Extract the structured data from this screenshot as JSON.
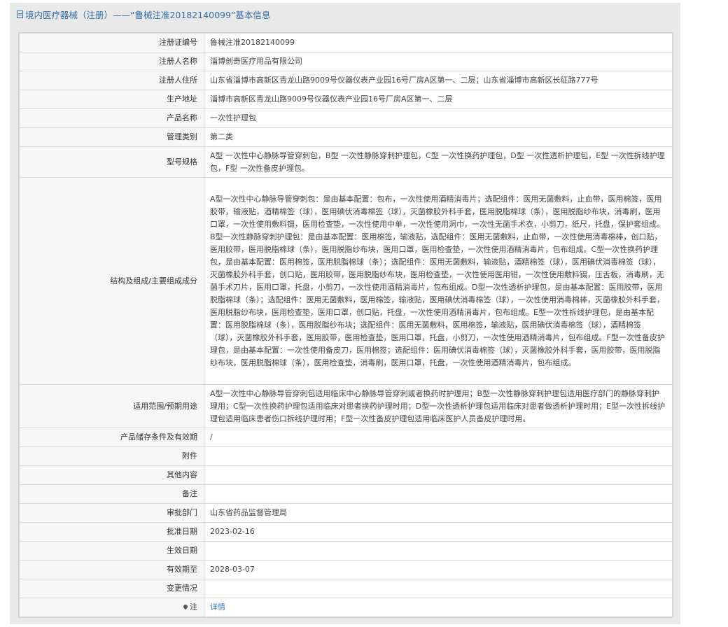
{
  "title": "境内医疗器械（注册）——“鲁械注准20182140099”基本信息",
  "rows": [
    {
      "label": "注册证编号",
      "value": "鲁械注准20182140099"
    },
    {
      "label": "注册人名称",
      "value": "淄博创奇医疗用品有限公司"
    },
    {
      "label": "注册人住所",
      "value": "山东省淄博市高新区青龙山路9009号仪器仪表产业园16号厂房A区第一、二层；山东省淄博市高新区长征路777号"
    },
    {
      "label": "生产地址",
      "value": "淄博市高新区青龙山路9009号仪器仪表产业园16号厂房A区第一、二层"
    },
    {
      "label": "产品名称",
      "value": "一次性护理包"
    },
    {
      "label": "管理类别",
      "value": "第二类"
    },
    {
      "label": "型号规格",
      "value": "A型 一次性中心静脉导管穿刺包，B型 一次性静脉穿刺护理包，C型 一次性换药护理包，D型 一次性透析护理包，E型 一次性拆线护理包，F型 一次性备皮护理包。"
    },
    {
      "label": "结构及组成/主要组成成分",
      "value": "A型一次性中心静脉导管穿刺包：是由基本配置：包布，一次性使用酒精消毒片；选配组件：医用无菌敷料，止血带，医用棉签，医用胶带，输液贴，酒精棉签（球），医用碘伏消毒棉签（球），灭菌橡胶外科手套，医用脱脂棉球（条），医用脱脂纱布块，消毒刷，医用口罩，一次性使用敷料镊，医用检查垫，一次性使用中单，一次性使用洞巾，一次性无菌手术衣，小剪刀，纸尺，托盘，保护套组成。\nB型一次性静脉穿刺护理包：是由基本配置：医用棉签，输液贴，选配组件：医用无菌敷料，止血带，一次性使用消毒棉棒，创口贴，医用胶带，医用脱脂棉球（条），医用脱脂纱布块，医用口罩，医用检查垫，一次性使用酒精消毒片，包布组成。C型一次性换药护理包，是由基本配置：医用棉签，医用脱脂棉球（条）；选配组件：医用无菌敷料，输液贴，酒精棉签（球），医用碘伏消毒棉签（球），灭菌橡胶外科手套，创口贴，医用胶带，医用脱脂纱布块，医用检查垫，一次性使用医用钳，一次性使用敷料镊，压舌板，消毒刷，无菌手术刀片，医用口罩，托盘，小剪刀，一次性使用酒精消毒片，包布组成。D型一次性透析护理包，是由基本配置：医用胶带，医用脱脂棉球（条）；选配组件：医用无菌敷料，医用棉签，输液贴，医用碘伏消毒棉签（球），一次性使用消毒棉棒，灭菌橡胶外科手套，医用脱脂纱布块，医用检查垫，医用口罩，创口贴，托盘，一次性使用酒精消毒片，包布组成。E型一次性拆线护理包，是由基本配置：医用脱脂棉球（条），医用脱脂纱布块；选配组件：医用无菌敷料，医用棉签，输液贴，医用碘伏消毒棉签（球），酒精棉签（球），灭菌橡胶外科手套，医用胶带，医用检查垫，医用口罩，托盘，小剪刀，一次性使用酒精消毒片，包布组成。F型一次性备皮护理包，是由基本配置：一次性使用备皮刀，医用棉签；选配组件：医用碘伏消毒棉签（球），灭菌橡胶外科手套，医用胶带，医用脱脂纱布块，医用脱脂棉球（条），医用检查垫，消毒刷，医用口罩，托盘，一次性使用酒精消毒片，包布组成。"
    },
    {
      "label": "适用范围/预期用途",
      "value": "A型一次性中心静脉导管穿刺包适用临床中心静脉导管穿刺或者换药时护理用；B型一次性静脉穿刺护理包适用医疗部门的静脉穿刺护理用；C型一次性换药护理包适用临床对患者换药护理时用；D型一次性透析护理包适用临床对患者做透析护理时用；E型一次性拆线护理包适用临床患者伤口拆线护理时用；F型一次性备皮护理包适用临床医护人员备皮护理时用。"
    },
    {
      "label": "产品储存条件及有效期",
      "value": "/"
    },
    {
      "label": "附件",
      "value": ""
    },
    {
      "label": "其他内容",
      "value": ""
    },
    {
      "label": "备注",
      "value": ""
    },
    {
      "label": "审批部门",
      "value": "山东省药品监督管理局"
    },
    {
      "label": "批准日期",
      "value": "2023-02-16"
    },
    {
      "label": "生效日期",
      "value": ""
    },
    {
      "label": "有效期至",
      "value": "2028-03-07"
    },
    {
      "label": "变更情况",
      "value": ""
    },
    {
      "label": "注",
      "value": "详情"
    }
  ],
  "icons": {
    "title": "document-icon",
    "note": "location-pin-icon"
  },
  "colors": {
    "title": "#2f6ca8",
    "link": "#3a78c3",
    "panel": "#e9e9e9"
  }
}
